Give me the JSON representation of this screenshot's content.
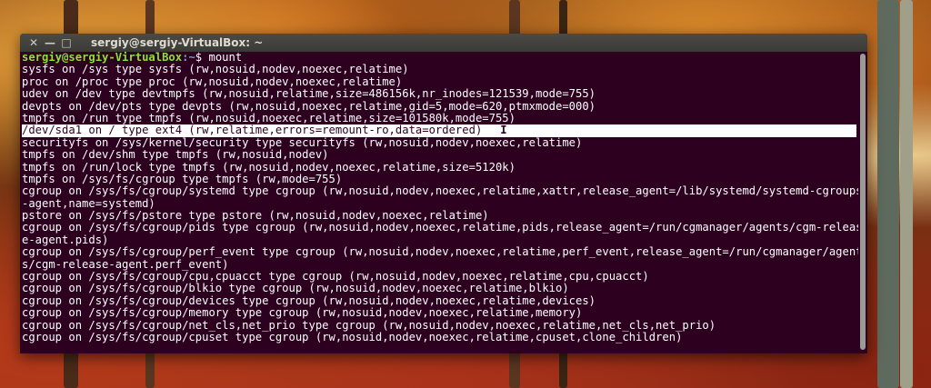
{
  "window": {
    "title": "sergiy@sergiy-VirtualBox: ~",
    "close_glyph": "✕",
    "minimize_glyph": "—",
    "maximize_glyph": "□"
  },
  "prompt": {
    "user_host": "sergiy@sergiy-VirtualBox",
    "path": ":~",
    "symbol": "$ ",
    "command": "mount"
  },
  "output_lines": [
    "sysfs on /sys type sysfs (rw,nosuid,nodev,noexec,relatime)",
    "proc on /proc type proc (rw,nosuid,nodev,noexec,relatime)",
    "udev on /dev type devtmpfs (rw,nosuid,relatime,size=486156k,nr_inodes=121539,mode=755)",
    "devpts on /dev/pts type devpts (rw,nosuid,noexec,relatime,gid=5,mode=620,ptmxmode=000)",
    "tmpfs on /run type tmpfs (rw,nosuid,noexec,relatime,size=101580k,mode=755)",
    "/dev/sda1 on / type ext4 (rw,relatime,errors=remount-ro,data=ordered)",
    "securityfs on /sys/kernel/security type securityfs (rw,nosuid,nodev,noexec,relatime)",
    "tmpfs on /dev/shm type tmpfs (rw,nosuid,nodev)",
    "tmpfs on /run/lock type tmpfs (rw,nosuid,nodev,noexec,relatime,size=5120k)",
    "tmpfs on /sys/fs/cgroup type tmpfs (rw,mode=755)",
    "cgroup on /sys/fs/cgroup/systemd type cgroup (rw,nosuid,nodev,noexec,relatime,xattr,release_agent=/lib/systemd/systemd-cgroups",
    "-agent,name=systemd)",
    "pstore on /sys/fs/pstore type pstore (rw,nosuid,nodev,noexec,relatime)",
    "cgroup on /sys/fs/cgroup/pids type cgroup (rw,nosuid,nodev,noexec,relatime,pids,release_agent=/run/cgmanager/agents/cgm-releas",
    "e-agent.pids)",
    "cgroup on /sys/fs/cgroup/perf_event type cgroup (rw,nosuid,nodev,noexec,relatime,perf_event,release_agent=/run/cgmanager/agent",
    "s/cgm-release-agent.perf_event)",
    "cgroup on /sys/fs/cgroup/cpu,cpuacct type cgroup (rw,nosuid,nodev,noexec,relatime,cpu,cpuacct)",
    "cgroup on /sys/fs/cgroup/blkio type cgroup (rw,nosuid,nodev,noexec,relatime,blkio)",
    "cgroup on /sys/fs/cgroup/devices type cgroup (rw,nosuid,nodev,noexec,relatime,devices)",
    "cgroup on /sys/fs/cgroup/memory type cgroup (rw,nosuid,nodev,noexec,relatime,memory)",
    "cgroup on /sys/fs/cgroup/net_cls,net_prio type cgroup (rw,nosuid,nodev,noexec,relatime,net_cls,net_prio)",
    "cgroup on /sys/fs/cgroup/cpuset type cgroup (rw,nosuid,nodev,noexec,relatime,cpuset,clone_children)"
  ],
  "highlighted_line_index": 5,
  "colors": {
    "terminal_bg": "#2c001e",
    "prompt_user": "#8ae234",
    "prompt_path": "#729fcf",
    "text": "#ffffff",
    "highlight_bg": "#ffffff"
  },
  "icons": {
    "text_cursor": "ibeam-cursor-icon"
  }
}
